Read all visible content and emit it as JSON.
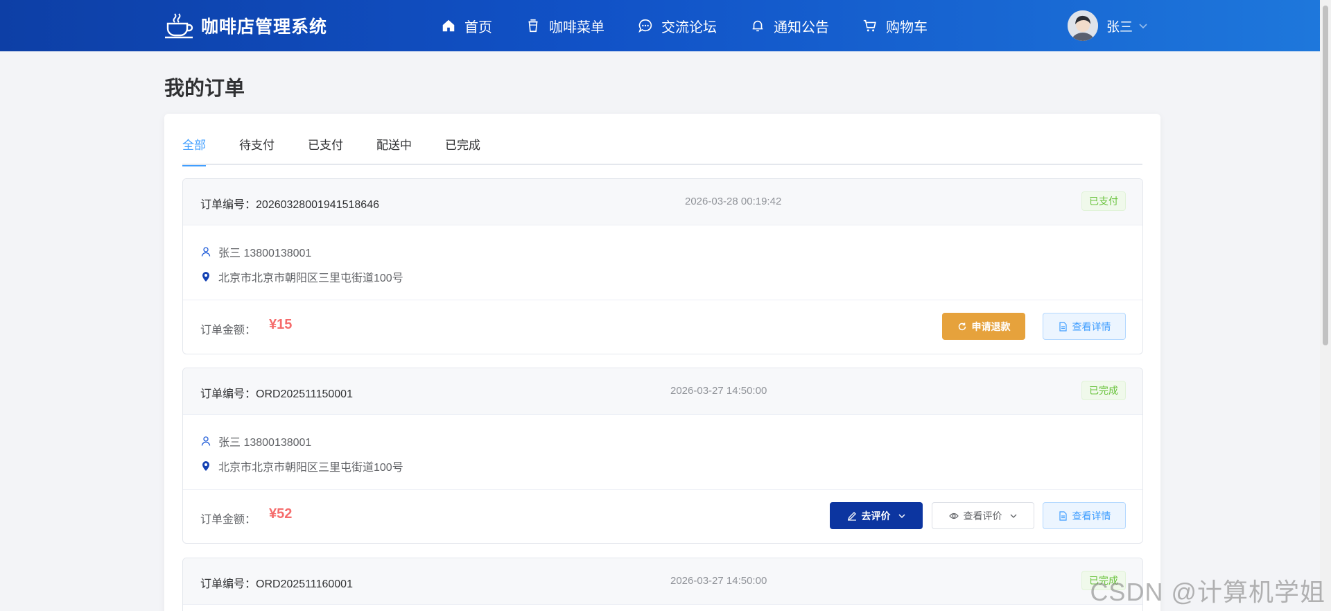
{
  "header": {
    "brand_icon": "coffee-cup-icon",
    "brand_title": "咖啡店管理系统",
    "nav": [
      {
        "label": "首页",
        "icon": "home-icon"
      },
      {
        "label": "咖啡菜单",
        "icon": "coffee-icon"
      },
      {
        "label": "交流论坛",
        "icon": "chat-icon"
      },
      {
        "label": "通知公告",
        "icon": "bell-icon"
      },
      {
        "label": "购物车",
        "icon": "cart-icon"
      }
    ],
    "user_name": "张三"
  },
  "page": {
    "title": "我的订单"
  },
  "tabs": [
    {
      "label": "全部",
      "active": true
    },
    {
      "label": "待支付",
      "active": false
    },
    {
      "label": "已支付",
      "active": false
    },
    {
      "label": "配送中",
      "active": false
    },
    {
      "label": "已完成",
      "active": false
    }
  ],
  "labels": {
    "order_no": "订单编号：",
    "amount": "订单金额："
  },
  "orders": [
    {
      "order_no": "20260328001941518646",
      "time": "2026-03-28 00:19:42",
      "status": "已支付",
      "contact": "张三 13800138001",
      "address": "北京市北京市朝阳区三里屯街道100号",
      "amount": "¥15",
      "actions": [
        "申请退款",
        "查看详情"
      ]
    },
    {
      "order_no": "ORD202511150001",
      "time": "2026-03-27 14:50:00",
      "status": "已完成",
      "contact": "张三 13800138001",
      "address": "北京市北京市朝阳区三里屯街道100号",
      "amount": "¥52",
      "actions": [
        "去评价",
        "查看评价",
        "查看详情"
      ]
    },
    {
      "order_no": "ORD202511160001",
      "time": "2026-03-27 14:50:00",
      "status": "已完成"
    }
  ],
  "watermark": "CSDN @计算机学姐",
  "colors": {
    "header_start": "#0d3fa6",
    "header_end": "#1e78dc",
    "active_tab": "#409eff",
    "price": "#f56c6c",
    "status_green": "#67c23a",
    "refund": "#e6a23c",
    "review": "#0c35a0"
  }
}
